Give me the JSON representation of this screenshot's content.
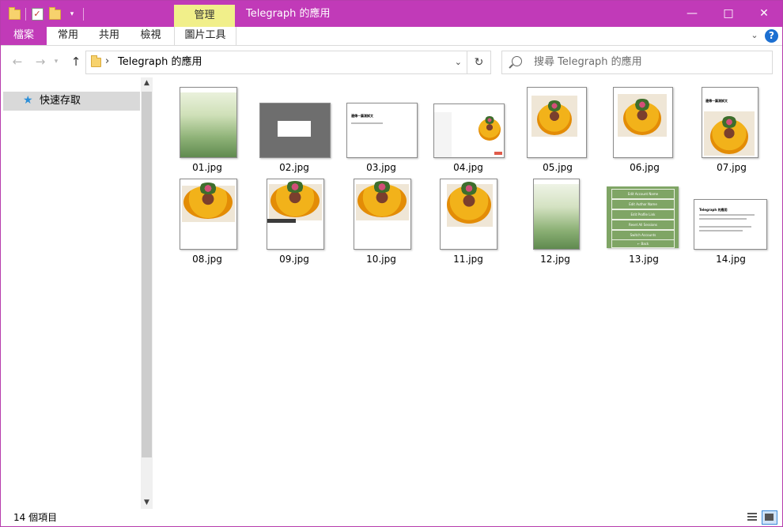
{
  "window": {
    "title": "Telegraph 的應用",
    "context_tab": "管理",
    "controls": {
      "minimize": "—",
      "maximize": "□",
      "close": "✕"
    }
  },
  "ribbon": {
    "tabs": [
      "檔案",
      "常用",
      "共用",
      "檢視",
      "圖片工具"
    ]
  },
  "address": {
    "path": "Telegraph 的應用",
    "search_placeholder": "搜尋 Telegraph 的應用"
  },
  "navpane": {
    "quick_access": "快速存取"
  },
  "files": [
    {
      "name": "01.jpg"
    },
    {
      "name": "02.jpg"
    },
    {
      "name": "03.jpg"
    },
    {
      "name": "04.jpg"
    },
    {
      "name": "05.jpg"
    },
    {
      "name": "06.jpg"
    },
    {
      "name": "07.jpg"
    },
    {
      "name": "08.jpg"
    },
    {
      "name": "09.jpg"
    },
    {
      "name": "10.jpg"
    },
    {
      "name": "11.jpg"
    },
    {
      "name": "12.jpg"
    },
    {
      "name": "13.jpg"
    },
    {
      "name": "14.jpg"
    }
  ],
  "thumb13_menu": [
    "Edit Account Name",
    "Edit Author Name",
    "Edit Profile Link",
    "Reset All Sessions",
    "Switch Accounts",
    "← Back"
  ],
  "thumb03_heading": "邊傳一篇測試文",
  "thumb07_heading": "邊傳一篇測試文",
  "thumb14_heading": "Telegraph 的應用",
  "status": {
    "item_count": "14 個項目"
  },
  "colors": {
    "titlebar": "#c13ab8",
    "context_tab": "#f1ef8a",
    "selection": "#d9d9d9",
    "accent": "#1c6fd1"
  }
}
